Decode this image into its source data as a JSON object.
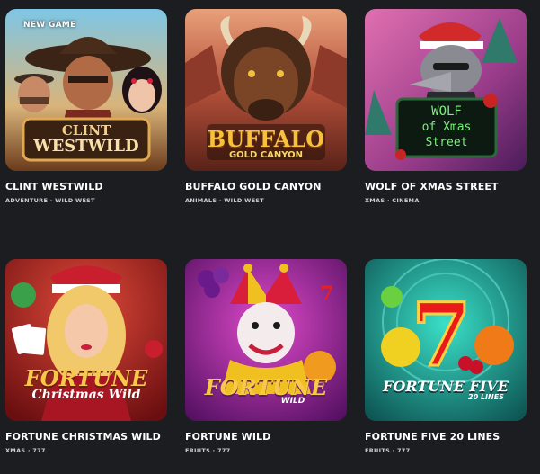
{
  "games": [
    {
      "badge": "NEW GAME",
      "title": "CLINT WESTWILD",
      "tags": "ADVENTURE · WILD WEST",
      "logo": [
        "CLINT",
        "WESTWILD"
      ],
      "art": "western-outlaws-art"
    },
    {
      "badge": "",
      "title": "BUFFALO GOLD CANYON",
      "tags": "ANIMALS · WILD WEST",
      "logo": [
        "BUFFALO",
        "GOLD CANYON"
      ],
      "art": "buffalo-art"
    },
    {
      "badge": "",
      "title": "WOLF OF XMAS STREET",
      "tags": "XMAS · CINEMA",
      "logo": [
        "WOLF",
        "of Xmas",
        "Street"
      ],
      "art": "wolf-santa-art"
    },
    {
      "badge": "",
      "title": "FORTUNE CHRISTMAS WILD",
      "tags": "XMAS · 777",
      "logo": [
        "FORTUNE",
        "Christmas Wild"
      ],
      "art": "christmas-woman-art"
    },
    {
      "badge": "",
      "title": "FORTUNE WILD",
      "tags": "FRUITS · 777",
      "logo": [
        "FORTUNE",
        "WILD"
      ],
      "art": "jester-art"
    },
    {
      "badge": "",
      "title": "FORTUNE FIVE 20 LINES",
      "tags": "FRUITS · 777",
      "logo": [
        "FORTUNE FIVE",
        "20 LINES"
      ],
      "art": "lucky-seven-fruits-art"
    }
  ]
}
